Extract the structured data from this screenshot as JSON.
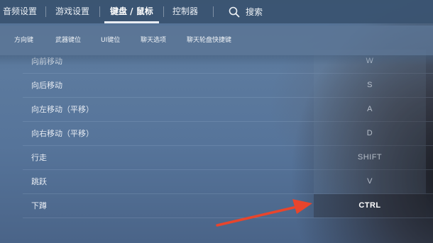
{
  "top_nav": {
    "tabs": [
      {
        "label": "音频设置",
        "active": false
      },
      {
        "label": "游戏设置",
        "active": false
      },
      {
        "label": "键盘 / 鼠标",
        "active": true
      },
      {
        "label": "控制器",
        "active": false
      }
    ],
    "search": {
      "label": "搜索",
      "icon": "search-icon"
    }
  },
  "sub_nav": {
    "items": [
      {
        "label": "方向键"
      },
      {
        "label": "武器键位"
      },
      {
        "label": "UI键位"
      },
      {
        "label": "聊天选项"
      },
      {
        "label": "聊天轮盘快捷键"
      }
    ]
  },
  "bindings": [
    {
      "action": "向前移动",
      "key": "W",
      "highlighted": false
    },
    {
      "action": "向后移动",
      "key": "S",
      "highlighted": false
    },
    {
      "action": "向左移动（平移）",
      "key": "A",
      "highlighted": false
    },
    {
      "action": "向右移动（平移）",
      "key": "D",
      "highlighted": false
    },
    {
      "action": "行走",
      "key": "SHIFT",
      "highlighted": false
    },
    {
      "action": "跳跃",
      "key": "V",
      "highlighted": false
    },
    {
      "action": "下蹲",
      "key": "CTRL",
      "highlighted": true
    }
  ],
  "colors": {
    "arrow": "#e8452c",
    "top_nav_bg": "#3a5270",
    "active_underline": "#e8edf3"
  }
}
